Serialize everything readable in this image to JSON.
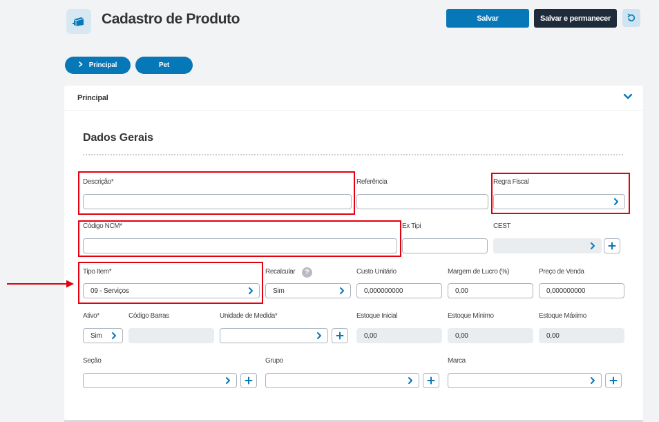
{
  "header": {
    "title": "Cadastro de Produto",
    "save_label": "Salvar",
    "save_stay_label": "Salvar e permanecer"
  },
  "tabs": [
    {
      "label": "Principal",
      "active": true
    },
    {
      "label": "Pet",
      "active": false
    }
  ],
  "panel": {
    "title": "Principal",
    "section_title": "Dados Gerais"
  },
  "form": {
    "descricao": {
      "label": "Descrição*",
      "value": ""
    },
    "referencia": {
      "label": "Referência",
      "value": ""
    },
    "regra_fiscal": {
      "label": "Regra Fiscal",
      "value": ""
    },
    "codigo_ncm": {
      "label": "Código NCM*",
      "value": ""
    },
    "ex_tipi": {
      "label": "Ex Tipi",
      "value": ""
    },
    "cest": {
      "label": "CEST",
      "value": ""
    },
    "tipo_item": {
      "label": "Tipo Item*",
      "value": "09 - Serviços"
    },
    "recalcular": {
      "label": "Recalcular",
      "value": "Sim",
      "help": "?"
    },
    "custo_unitario": {
      "label": "Custo Unitário",
      "value": "0,000000000"
    },
    "margem_lucro": {
      "label": "Margem de Lucro (%)",
      "value": "0,00"
    },
    "preco_venda": {
      "label": "Preço de Venda",
      "value": "0,000000000"
    },
    "ativo": {
      "label": "Ativo*",
      "value": "Sim"
    },
    "codigo_barras": {
      "label": "Código Barras",
      "value": ""
    },
    "unidade_medida": {
      "label": "Unidade de Medida*",
      "value": ""
    },
    "estoque_inicial": {
      "label": "Estoque Inicial",
      "value": "0,00"
    },
    "estoque_minimo": {
      "label": "Estoque Mínimo",
      "value": "0,00"
    },
    "estoque_maximo": {
      "label": "Estoque Máximo",
      "value": "0,00"
    },
    "secao": {
      "label": "Seção",
      "value": ""
    },
    "grupo": {
      "label": "Grupo",
      "value": ""
    },
    "marca": {
      "label": "Marca",
      "value": ""
    }
  },
  "colors": {
    "primary": "#0677b7",
    "dark": "#1d2b3a",
    "highlight": "#e3000f",
    "disabled_bg": "#eaedf0"
  },
  "icons": {
    "logo": "box-icon",
    "undo": "undo-icon",
    "toggle": "chevron-down-icon",
    "select": "chevron-right-icon",
    "add": "plus-icon"
  }
}
